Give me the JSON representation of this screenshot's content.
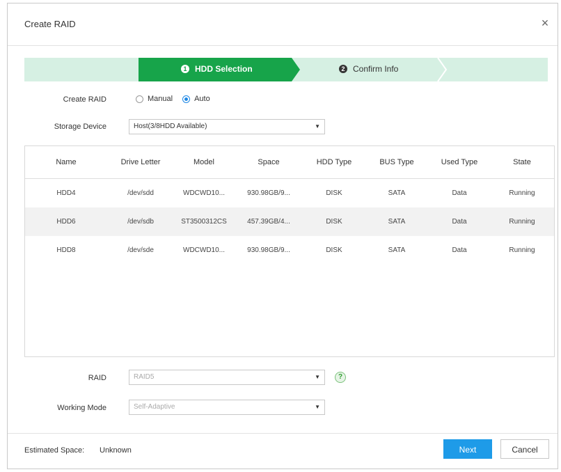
{
  "dialog": {
    "title": "Create RAID"
  },
  "steps": [
    {
      "number": "1",
      "label": "HDD Selection",
      "active": true
    },
    {
      "number": "2",
      "label": "Confirm Info",
      "active": false
    }
  ],
  "colors": {
    "step_active": "#17a44a",
    "step_inactive": "#d6f0e3",
    "primary_button": "#1e9be8",
    "radio_checked": "#1e88e5"
  },
  "form": {
    "create_raid_label": "Create RAID",
    "mode_options": [
      {
        "label": "Manual",
        "checked": false
      },
      {
        "label": "Auto",
        "checked": true
      }
    ],
    "storage_device_label": "Storage Device",
    "storage_device_value": "Host(3/8HDD Available)"
  },
  "table": {
    "columns": [
      "Name",
      "Drive Letter",
      "Model",
      "Space",
      "HDD Type",
      "BUS Type",
      "Used Type",
      "State"
    ],
    "rows": [
      [
        "HDD4",
        "/dev/sdd",
        "WDCWD10...",
        "930.98GB/9...",
        "DISK",
        "SATA",
        "Data",
        "Running"
      ],
      [
        "HDD6",
        "/dev/sdb",
        "ST3500312CS",
        "457.39GB/4...",
        "DISK",
        "SATA",
        "Data",
        "Running"
      ],
      [
        "HDD8",
        "/dev/sde",
        "WDCWD10...",
        "930.98GB/9...",
        "DISK",
        "SATA",
        "Data",
        "Running"
      ]
    ]
  },
  "raid": {
    "label": "RAID",
    "value": "RAID5",
    "help": "?"
  },
  "working_mode": {
    "label": "Working Mode",
    "value": "Self-Adaptive"
  },
  "footer": {
    "estimated_space_label": "Estimated Space:",
    "estimated_space_value": "Unknown",
    "next_label": "Next",
    "cancel_label": "Cancel"
  },
  "icons": {
    "close": "×",
    "dropdown": "▼"
  }
}
